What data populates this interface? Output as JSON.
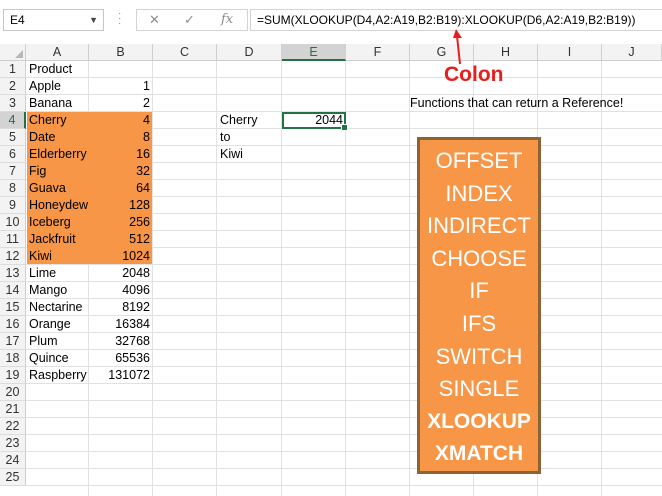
{
  "name_box": "E4",
  "formula_bar": {
    "cancel_icon": "x-icon",
    "enter_icon": "check-icon",
    "fx_label": "fx",
    "formula": "=SUM(XLOOKUP(D4,A2:A19,B2:B19):XLOOKUP(D6,A2:A19,B2:B19))"
  },
  "columns": [
    "A",
    "B",
    "C",
    "D",
    "E",
    "F",
    "G",
    "H",
    "I",
    "J"
  ],
  "selected_column": "E",
  "selected_row": "4",
  "rows": [
    "1",
    "2",
    "3",
    "4",
    "5",
    "6",
    "7",
    "8",
    "9",
    "10",
    "11",
    "12",
    "13",
    "14",
    "15",
    "16",
    "17",
    "18",
    "19",
    "20",
    "21",
    "22",
    "23",
    "24",
    "25"
  ],
  "table": [
    {
      "name": "Product",
      "value": ""
    },
    {
      "name": "Apple",
      "value": "1"
    },
    {
      "name": "Banana",
      "value": "2"
    },
    {
      "name": "Cherry",
      "value": "4"
    },
    {
      "name": "Date",
      "value": "8"
    },
    {
      "name": "Elderberry",
      "value": "16"
    },
    {
      "name": "Fig",
      "value": "32"
    },
    {
      "name": "Guava",
      "value": "64"
    },
    {
      "name": "Honeydew",
      "value": "128"
    },
    {
      "name": "Iceberg",
      "value": "256"
    },
    {
      "name": "Jackfruit",
      "value": "512"
    },
    {
      "name": "Kiwi",
      "value": "1024"
    },
    {
      "name": "Lime",
      "value": "2048"
    },
    {
      "name": "Mango",
      "value": "4096"
    },
    {
      "name": "Nectarine",
      "value": "8192"
    },
    {
      "name": "Orange",
      "value": "16384"
    },
    {
      "name": "Plum",
      "value": "32768"
    },
    {
      "name": "Quince",
      "value": "65536"
    },
    {
      "name": "Raspberry",
      "value": "131072"
    }
  ],
  "lookup": {
    "start": "Cherry",
    "to": "to",
    "end": "Kiwi",
    "result": "2044"
  },
  "annotation": {
    "colon_label": "Colon",
    "note": "Functions that can return a Reference!"
  },
  "functions": [
    "OFFSET",
    "INDEX",
    "INDIRECT",
    "CHOOSE",
    "IF",
    "IFS",
    "SWITCH",
    "SINGLE",
    "XLOOKUP",
    "XMATCH"
  ],
  "highlight_color": "#f79646",
  "annotation_color": "#e81e1e"
}
